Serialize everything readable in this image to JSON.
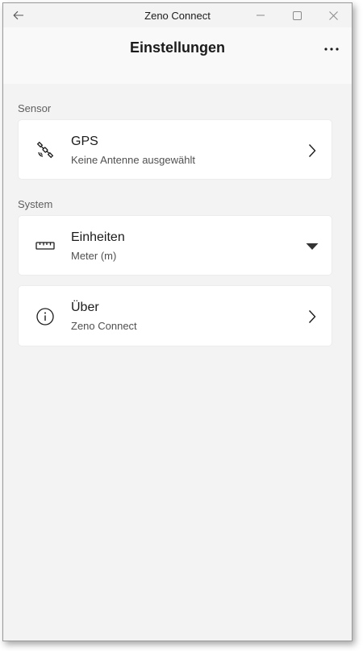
{
  "window": {
    "title": "Zeno Connect"
  },
  "header": {
    "page_title": "Einstellungen",
    "more_label": "···"
  },
  "sections": {
    "sensor": {
      "label": "Sensor",
      "gps": {
        "title": "GPS",
        "subtitle": "Keine Antenne ausgewählt",
        "icon": "satellite-icon"
      }
    },
    "system": {
      "label": "System",
      "units": {
        "title": "Einheiten",
        "subtitle": "Meter (m)",
        "icon": "ruler-icon"
      },
      "about": {
        "title": "Über",
        "subtitle": "Zeno Connect",
        "icon": "info-icon"
      }
    }
  },
  "colors": {
    "background": "#f3f3f3",
    "card": "#ffffff",
    "text": "#1b1b1b",
    "secondary_text": "#505050"
  }
}
